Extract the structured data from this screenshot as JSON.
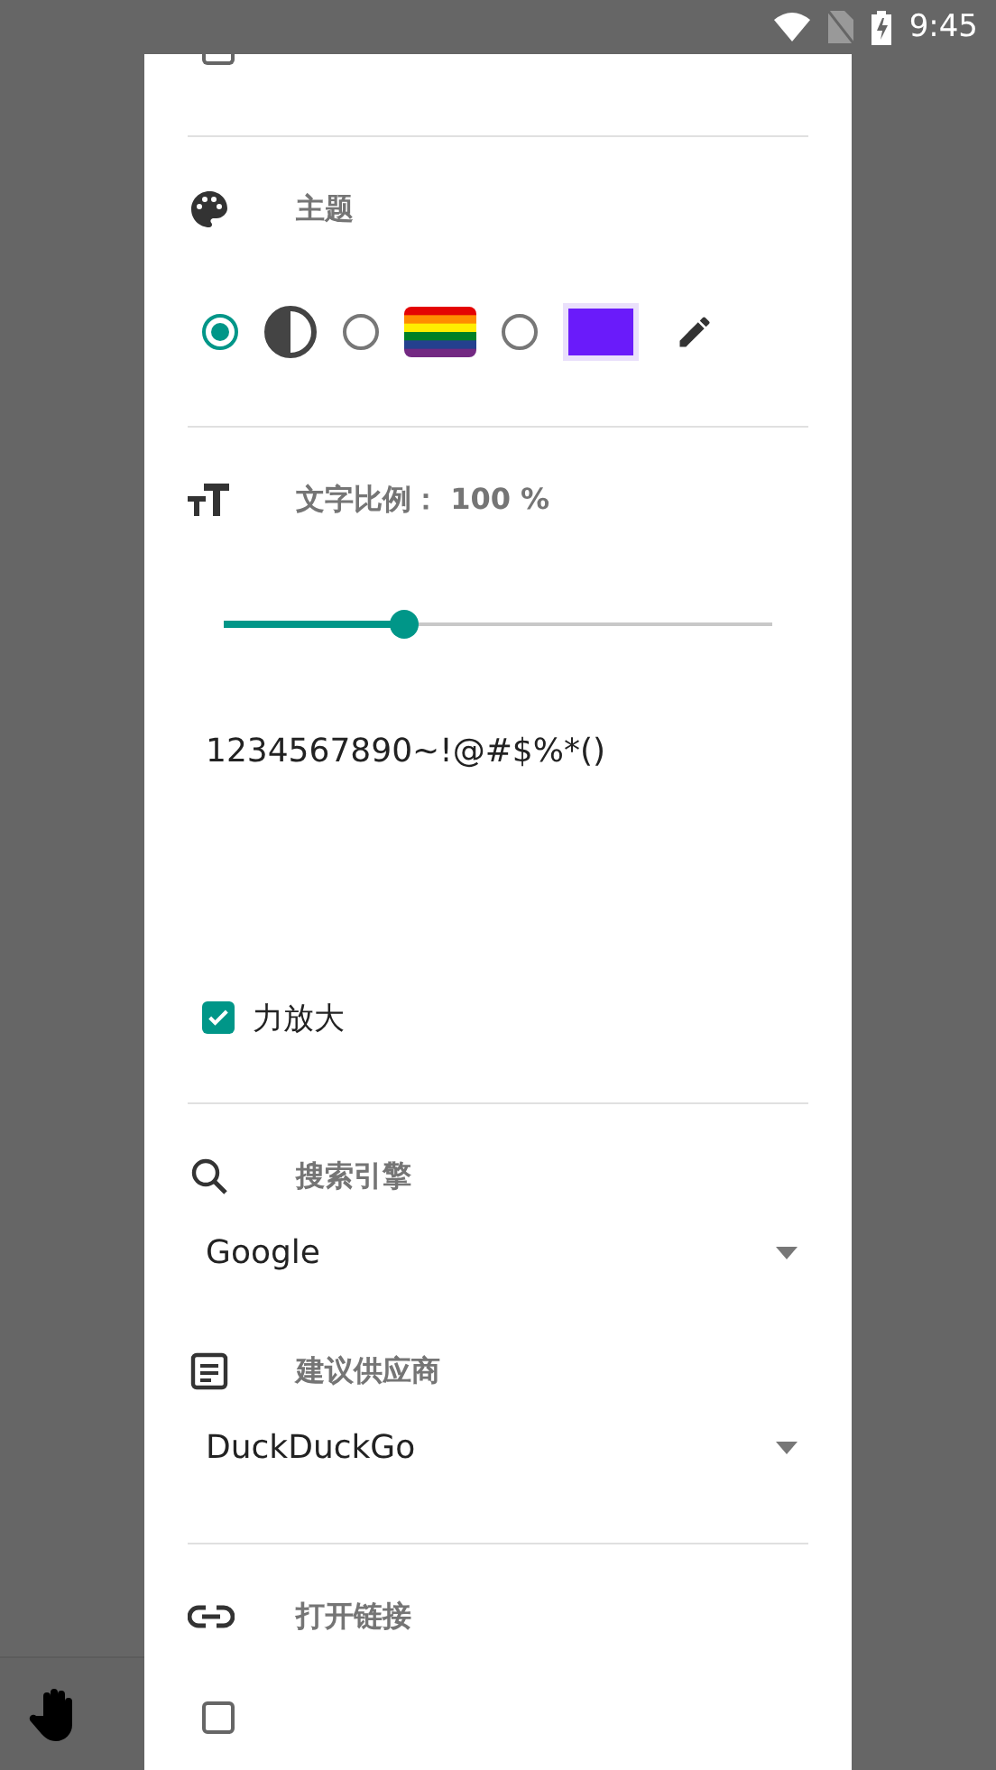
{
  "status_bar": {
    "time": "9:45"
  },
  "download_folder": {
    "checked": false
  },
  "theme": {
    "title": "主题",
    "options": [
      {
        "kind": "contrast",
        "selected": true
      },
      {
        "kind": "rainbow",
        "selected": false
      },
      {
        "kind": "color",
        "color": "#6a1bfa",
        "selected": false
      }
    ]
  },
  "text_scale": {
    "label": "文字比例： 100 %",
    "level": 0.33,
    "sample": "1234567890~!@#$%*()",
    "force_zoom": {
      "label": "力放大",
      "checked": true
    }
  },
  "search_engine": {
    "title": "搜索引擎",
    "value": "Google"
  },
  "suggestions": {
    "title": "建议供应商",
    "value": "DuckDuckGo"
  },
  "open_links": {
    "title": "打开链接",
    "checked": false
  }
}
